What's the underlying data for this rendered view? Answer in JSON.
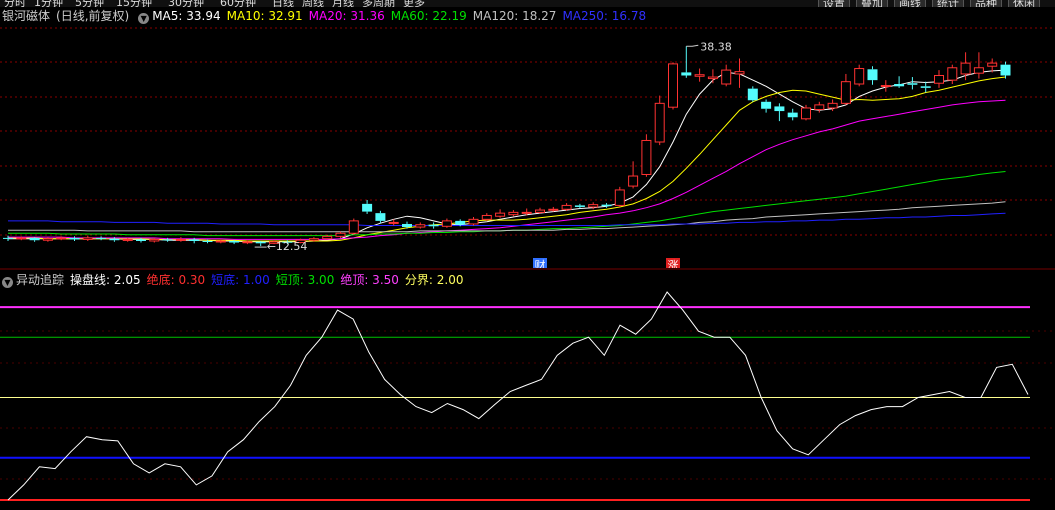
{
  "top_tabs": [
    "分时",
    "1分钟",
    "5分钟",
    "15分钟",
    "30分钟",
    "60分钟",
    "日线",
    "周线",
    "月线",
    "多周期",
    "更多"
  ],
  "right_tabs": [
    "设置",
    "叠加",
    "画线",
    "统计",
    "品种",
    "休闲"
  ],
  "stock": {
    "name": "银河磁体",
    "period": "(日线,前复权)"
  },
  "colors": {
    "up": "#ff3232",
    "down": "#54fcfc",
    "ma5": "#ffffff",
    "ma10": "#ffff00",
    "ma20": "#ff00ff",
    "ma60": "#00e000",
    "ma120": "#c0c0c0",
    "ma250": "#2020ff"
  },
  "main_legend": [
    {
      "label": "MA5: 33.94",
      "color": "#ffffff"
    },
    {
      "label": "MA10: 32.91",
      "color": "#ffff00"
    },
    {
      "label": "MA20: 31.36",
      "color": "#ff00ff"
    },
    {
      "label": "MA60: 22.19",
      "color": "#00e000"
    },
    {
      "label": "MA120: 18.27",
      "color": "#c0c0c0"
    },
    {
      "label": "MA250: 16.78",
      "color": "#3030ff"
    }
  ],
  "sub_legend": {
    "title": "异动追踪",
    "items": [
      {
        "label": "操盘线: 2.05",
        "color": "#ffffff"
      },
      {
        "label": "绝底: 0.30",
        "color": "#ff3030"
      },
      {
        "label": "短底: 1.00",
        "color": "#2020ff"
      },
      {
        "label": "短顶: 3.00",
        "color": "#00e000"
      },
      {
        "label": "绝顶: 3.50",
        "color": "#ff40ff"
      },
      {
        "label": "分界: 2.00",
        "color": "#ffff60"
      }
    ]
  },
  "chart_data": [
    {
      "type": "candlestick",
      "title": "银河磁体(日线,前复权)",
      "ylim": [
        11,
        41
      ],
      "annotations": [
        {
          "text": "38.38",
          "index": 51
        },
        {
          "text": "12.54",
          "index": 19
        }
      ],
      "event_markers": [
        {
          "text": "财",
          "index": 40,
          "color": "#3070ff"
        },
        {
          "text": "涨",
          "index": 50,
          "color": "#e02020"
        }
      ],
      "candles": [
        [
          13.6,
          13.5,
          13.9,
          13.2
        ],
        [
          13.5,
          13.6,
          13.8,
          13.3
        ],
        [
          13.6,
          13.3,
          13.7,
          13.1
        ],
        [
          13.3,
          13.5,
          13.7,
          13.1
        ],
        [
          13.5,
          13.6,
          13.8,
          13.3
        ],
        [
          13.6,
          13.4,
          13.8,
          13.2
        ],
        [
          13.4,
          13.6,
          13.9,
          13.2
        ],
        [
          13.6,
          13.5,
          13.8,
          13.3
        ],
        [
          13.5,
          13.3,
          13.7,
          13.1
        ],
        [
          13.3,
          13.4,
          13.6,
          13.1
        ],
        [
          13.4,
          13.2,
          13.6,
          13.0
        ],
        [
          13.2,
          13.4,
          13.6,
          13.0
        ],
        [
          13.4,
          13.3,
          13.6,
          13.1
        ],
        [
          13.3,
          13.4,
          13.7,
          13.1
        ],
        [
          13.4,
          13.2,
          13.6,
          12.9
        ],
        [
          13.2,
          13.1,
          13.4,
          12.9
        ],
        [
          13.1,
          13.2,
          13.4,
          12.9
        ],
        [
          13.2,
          13.0,
          13.3,
          12.8
        ],
        [
          13.0,
          13.1,
          13.3,
          12.8
        ],
        [
          13.1,
          12.9,
          13.2,
          12.54
        ],
        [
          12.9,
          13.1,
          13.3,
          12.8
        ],
        [
          13.1,
          13.0,
          13.3,
          12.8
        ],
        [
          13.0,
          13.3,
          13.5,
          12.9
        ],
        [
          13.3,
          13.5,
          13.7,
          13.1
        ],
        [
          13.5,
          13.8,
          14.0,
          13.4
        ],
        [
          13.8,
          14.2,
          14.4,
          13.6
        ],
        [
          14.2,
          15.8,
          16.1,
          14.0
        ],
        [
          18.0,
          17.0,
          18.5,
          16.7
        ],
        [
          16.8,
          15.8,
          17.1,
          15.5
        ],
        [
          15.5,
          15.6,
          16.0,
          15.2
        ],
        [
          15.4,
          15.0,
          15.7,
          14.8
        ],
        [
          15.0,
          15.3,
          15.6,
          14.8
        ],
        [
          15.3,
          15.1,
          15.6,
          14.8
        ],
        [
          15.1,
          15.8,
          16.1,
          14.9
        ],
        [
          15.8,
          15.3,
          16.0,
          15.1
        ],
        [
          15.4,
          16.0,
          16.3,
          15.2
        ],
        [
          16.0,
          16.5,
          16.8,
          15.8
        ],
        [
          16.4,
          16.8,
          17.3,
          16.2
        ],
        [
          16.6,
          16.9,
          17.2,
          16.4
        ],
        [
          16.8,
          16.9,
          17.4,
          16.5
        ],
        [
          16.9,
          17.2,
          17.5,
          16.7
        ],
        [
          17.2,
          17.3,
          17.6,
          17.0
        ],
        [
          17.3,
          17.8,
          18.1,
          17.1
        ],
        [
          17.8,
          17.6,
          18.0,
          17.4
        ],
        [
          17.6,
          17.9,
          18.2,
          17.3
        ],
        [
          17.9,
          17.7,
          18.1,
          17.5
        ],
        [
          17.8,
          19.8,
          20.2,
          17.6
        ],
        [
          20.3,
          21.6,
          23.5,
          20.0
        ],
        [
          21.8,
          26.2,
          27.0,
          21.5
        ],
        [
          26.0,
          31.0,
          32.0,
          25.6
        ],
        [
          30.5,
          36.1,
          36.3,
          30.2
        ],
        [
          35.0,
          34.6,
          38.38,
          34.3
        ],
        [
          34.5,
          34.7,
          35.5,
          33.8
        ],
        [
          34.2,
          34.4,
          35.4,
          33.6
        ],
        [
          33.5,
          35.3,
          36.0,
          33.2
        ],
        [
          34.8,
          35.1,
          36.8,
          33.0
        ],
        [
          32.9,
          31.4,
          33.2,
          31.2
        ],
        [
          31.2,
          30.3,
          31.5,
          29.8
        ],
        [
          30.6,
          30.0,
          31.0,
          28.7
        ],
        [
          29.8,
          29.2,
          30.3,
          28.8
        ],
        [
          29.0,
          30.4,
          30.8,
          28.8
        ],
        [
          30.2,
          30.8,
          31.2,
          29.8
        ],
        [
          30.4,
          31.0,
          31.5,
          30.0
        ],
        [
          31.0,
          33.8,
          34.8,
          30.8
        ],
        [
          33.5,
          35.5,
          36.0,
          33.2
        ],
        [
          35.4,
          34.0,
          35.8,
          33.4
        ],
        [
          33.2,
          33.3,
          34.0,
          32.5
        ],
        [
          33.5,
          33.2,
          34.5,
          33.0
        ],
        [
          33.6,
          33.4,
          34.4,
          32.8
        ],
        [
          33.2,
          33.0,
          33.8,
          32.4
        ],
        [
          33.6,
          34.6,
          35.3,
          33.0
        ],
        [
          34.0,
          35.6,
          36.0,
          33.5
        ],
        [
          34.8,
          36.2,
          37.6,
          34.0
        ],
        [
          34.9,
          35.6,
          37.6,
          34.2
        ],
        [
          35.8,
          36.2,
          36.8,
          35.0
        ],
        [
          36.0,
          34.6,
          36.4,
          34.2
        ]
      ],
      "ma": {
        "MA5": [
          13.5,
          13.5,
          13.5,
          13.5,
          13.5,
          13.5,
          13.5,
          13.5,
          13.5,
          13.4,
          13.4,
          13.4,
          13.3,
          13.3,
          13.3,
          13.3,
          13.2,
          13.2,
          13.1,
          13.1,
          13.1,
          13.1,
          13.1,
          13.2,
          13.3,
          13.5,
          14.1,
          14.9,
          15.5,
          16.0,
          16.4,
          16.2,
          15.8,
          15.4,
          15.3,
          15.5,
          15.7,
          16.0,
          16.3,
          16.6,
          16.8,
          17.0,
          17.2,
          17.4,
          17.5,
          17.7,
          18.1,
          18.9,
          20.5,
          22.8,
          26.0,
          29.6,
          32.2,
          34.0,
          35.0,
          34.8,
          34.0,
          33.2,
          32.2,
          31.2,
          30.3,
          30.1,
          30.3,
          30.8,
          31.9,
          32.6,
          33.1,
          33.4,
          33.8,
          33.7,
          33.8,
          34.0,
          34.6,
          35.0,
          35.2,
          35.3
        ],
        "MA10": [
          13.6,
          13.6,
          13.6,
          13.5,
          13.5,
          13.5,
          13.5,
          13.5,
          13.5,
          13.5,
          13.5,
          13.4,
          13.4,
          13.4,
          13.4,
          13.3,
          13.3,
          13.3,
          13.2,
          13.2,
          13.2,
          13.2,
          13.2,
          13.2,
          13.2,
          13.3,
          13.6,
          14.0,
          14.3,
          14.6,
          14.9,
          15.1,
          15.3,
          15.4,
          15.6,
          15.8,
          15.9,
          15.9,
          15.9,
          16.0,
          16.2,
          16.4,
          16.6,
          16.9,
          17.1,
          17.3,
          17.6,
          18.0,
          18.7,
          19.6,
          20.9,
          22.6,
          24.4,
          26.3,
          28.2,
          30.1,
          31.2,
          31.9,
          32.4,
          32.7,
          32.6,
          32.2,
          31.8,
          31.4,
          31.5,
          31.4,
          31.5,
          31.6,
          31.9,
          32.4,
          32.7,
          33.1,
          33.5,
          33.9,
          34.2,
          34.4
        ],
        "MA20": [
          13.7,
          13.7,
          13.7,
          13.7,
          13.7,
          13.6,
          13.6,
          13.6,
          13.6,
          13.6,
          13.6,
          13.6,
          13.5,
          13.5,
          13.5,
          13.5,
          13.5,
          13.4,
          13.4,
          13.4,
          13.4,
          13.4,
          13.4,
          13.4,
          13.4,
          13.5,
          13.6,
          13.7,
          13.9,
          14.0,
          14.2,
          14.3,
          14.4,
          14.5,
          14.6,
          14.7,
          14.8,
          14.9,
          15.1,
          15.3,
          15.5,
          15.7,
          15.9,
          16.1,
          16.3,
          16.6,
          16.8,
          17.1,
          17.5,
          18.0,
          18.7,
          19.5,
          20.4,
          21.3,
          22.2,
          23.2,
          24.1,
          25.0,
          25.7,
          26.3,
          26.8,
          27.3,
          27.7,
          28.2,
          28.7,
          29.0,
          29.3,
          29.6,
          29.9,
          30.2,
          30.5,
          30.8,
          31.0,
          31.2,
          31.3,
          31.4
        ],
        "MA60": [
          14.2,
          14.2,
          14.2,
          14.2,
          14.1,
          14.1,
          14.1,
          14.1,
          14.1,
          14.0,
          14.0,
          14.0,
          14.0,
          14.0,
          14.0,
          13.9,
          13.9,
          13.9,
          13.9,
          13.9,
          13.9,
          13.9,
          13.9,
          13.9,
          13.9,
          13.9,
          14.0,
          14.0,
          14.1,
          14.1,
          14.2,
          14.2,
          14.3,
          14.3,
          14.4,
          14.4,
          14.5,
          14.5,
          14.6,
          14.6,
          14.7,
          14.8,
          14.8,
          14.9,
          15.0,
          15.1,
          15.2,
          15.4,
          15.6,
          15.8,
          16.1,
          16.4,
          16.7,
          17.0,
          17.2,
          17.4,
          17.6,
          17.8,
          18.0,
          18.2,
          18.4,
          18.6,
          18.8,
          19.0,
          19.3,
          19.6,
          19.9,
          20.2,
          20.5,
          20.8,
          21.1,
          21.3,
          21.5,
          21.8,
          22.0,
          22.19
        ],
        "MA120": [
          14.6,
          14.6,
          14.6,
          14.6,
          14.6,
          14.6,
          14.5,
          14.5,
          14.5,
          14.5,
          14.5,
          14.5,
          14.5,
          14.5,
          14.4,
          14.4,
          14.4,
          14.4,
          14.4,
          14.4,
          14.4,
          14.4,
          14.4,
          14.4,
          14.4,
          14.4,
          14.4,
          14.4,
          14.4,
          14.4,
          14.4,
          14.5,
          14.5,
          14.5,
          14.5,
          14.5,
          14.5,
          14.5,
          14.6,
          14.6,
          14.6,
          14.6,
          14.7,
          14.7,
          14.8,
          14.8,
          14.9,
          15.0,
          15.1,
          15.2,
          15.3,
          15.4,
          15.6,
          15.7,
          15.9,
          16.0,
          16.1,
          16.3,
          16.4,
          16.5,
          16.6,
          16.7,
          16.8,
          16.9,
          17.0,
          17.1,
          17.2,
          17.3,
          17.5,
          17.6,
          17.7,
          17.8,
          17.9,
          18.0,
          18.1,
          18.27
        ],
        "MA250": [
          15.8,
          15.8,
          15.8,
          15.8,
          15.7,
          15.7,
          15.7,
          15.7,
          15.6,
          15.6,
          15.6,
          15.6,
          15.5,
          15.5,
          15.5,
          15.5,
          15.4,
          15.4,
          15.4,
          15.4,
          15.3,
          15.3,
          15.3,
          15.3,
          15.3,
          15.3,
          15.3,
          15.2,
          15.2,
          15.2,
          15.2,
          15.2,
          15.2,
          15.2,
          15.2,
          15.2,
          15.2,
          15.2,
          15.2,
          15.2,
          15.2,
          15.2,
          15.2,
          15.2,
          15.2,
          15.2,
          15.3,
          15.3,
          15.3,
          15.3,
          15.4,
          15.4,
          15.4,
          15.5,
          15.5,
          15.6,
          15.6,
          15.7,
          15.7,
          15.8,
          15.8,
          15.9,
          15.9,
          16.0,
          16.0,
          16.1,
          16.2,
          16.2,
          16.3,
          16.3,
          16.4,
          16.5,
          16.5,
          16.6,
          16.7,
          16.78
        ]
      }
    },
    {
      "type": "line",
      "title": "异动追踪",
      "ylim": [
        0.2,
        4.2
      ],
      "levels": [
        {
          "name": "绝底",
          "value": 0.3,
          "color": "#ff2020"
        },
        {
          "name": "短底",
          "value": 1.0,
          "color": "#1010ff"
        },
        {
          "name": "分界",
          "value": 2.0,
          "color": "#ffff90"
        },
        {
          "name": "短顶",
          "value": 3.0,
          "color": "#00c000"
        },
        {
          "name": "绝顶",
          "value": 3.5,
          "color": "#ff30ff"
        }
      ],
      "series": [
        {
          "name": "操盘线",
          "color": "#ffffff",
          "values": [
            0.3,
            0.55,
            0.85,
            0.82,
            1.1,
            1.35,
            1.3,
            1.28,
            0.9,
            0.75,
            0.9,
            0.85,
            0.55,
            0.7,
            1.1,
            1.3,
            1.6,
            1.85,
            2.2,
            2.7,
            3.0,
            3.45,
            3.3,
            2.75,
            2.3,
            2.05,
            1.85,
            1.75,
            1.9,
            1.8,
            1.65,
            1.88,
            2.1,
            2.2,
            2.3,
            2.7,
            2.9,
            3.0,
            2.7,
            3.2,
            3.05,
            3.3,
            3.75,
            3.45,
            3.1,
            3.0,
            3.0,
            2.7,
            2.0,
            1.45,
            1.15,
            1.05,
            1.3,
            1.55,
            1.7,
            1.8,
            1.85,
            1.85,
            2.0,
            2.05,
            2.1,
            2.0,
            2.0,
            2.5,
            2.55,
            2.05
          ]
        }
      ]
    }
  ]
}
